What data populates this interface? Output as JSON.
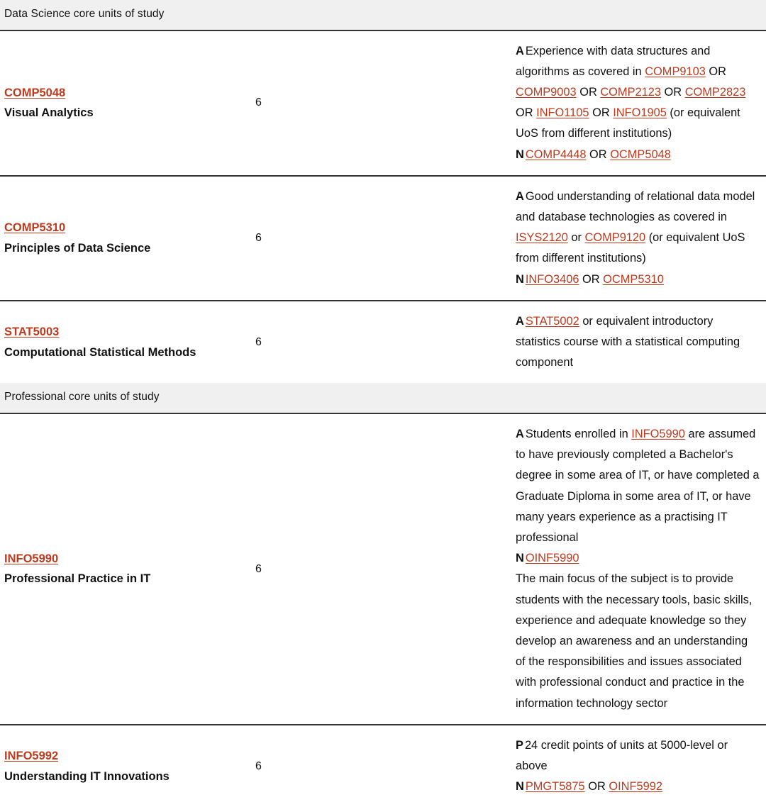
{
  "sections": [
    {
      "heading": "Data Science core units of study",
      "rows": [
        {
          "code": "COMP5048",
          "title": "Visual Analytics",
          "credit": "6",
          "requisites": [
            {
              "tag": "A",
              "parts": [
                {
                  "t": "text",
                  "v": "Experience with data structures and algorithms as covered in "
                },
                {
                  "t": "link",
                  "v": "COMP9103"
                },
                {
                  "t": "text",
                  "v": " OR "
                },
                {
                  "t": "link",
                  "v": "COMP9003"
                },
                {
                  "t": "text",
                  "v": " OR "
                },
                {
                  "t": "link",
                  "v": "COMP2123"
                },
                {
                  "t": "text",
                  "v": " OR "
                },
                {
                  "t": "link",
                  "v": "COMP2823"
                },
                {
                  "t": "text",
                  "v": " OR "
                },
                {
                  "t": "link",
                  "v": "INFO1105"
                },
                {
                  "t": "text",
                  "v": " OR "
                },
                {
                  "t": "link",
                  "v": "INFO1905"
                },
                {
                  "t": "text",
                  "v": " (or equivalent UoS from different institutions)"
                }
              ]
            },
            {
              "tag": "N",
              "parts": [
                {
                  "t": "link",
                  "v": "COMP4448"
                },
                {
                  "t": "text",
                  "v": " OR "
                },
                {
                  "t": "link",
                  "v": "OCMP5048"
                }
              ]
            }
          ],
          "description": ""
        },
        {
          "code": "COMP5310",
          "title": "Principles of Data Science",
          "credit": "6",
          "requisites": [
            {
              "tag": "A",
              "parts": [
                {
                  "t": "text",
                  "v": "Good understanding of relational data model and database technologies as covered in "
                },
                {
                  "t": "link",
                  "v": "ISYS2120"
                },
                {
                  "t": "text",
                  "v": " or "
                },
                {
                  "t": "link",
                  "v": "COMP9120"
                },
                {
                  "t": "text",
                  "v": " (or equivalent UoS from different institutions)"
                }
              ]
            },
            {
              "tag": "N",
              "parts": [
                {
                  "t": "link",
                  "v": "INFO3406"
                },
                {
                  "t": "text",
                  "v": " OR "
                },
                {
                  "t": "link",
                  "v": "OCMP5310"
                }
              ]
            }
          ],
          "description": ""
        },
        {
          "code": "STAT5003",
          "title": "Computational Statistical Methods",
          "credit": "6",
          "requisites": [
            {
              "tag": "A",
              "parts": [
                {
                  "t": "link",
                  "v": "STAT5002"
                },
                {
                  "t": "text",
                  "v": " or equivalent introductory statistics course with a statistical computing component"
                }
              ]
            }
          ],
          "description": ""
        }
      ]
    },
    {
      "heading": "Professional core units of study",
      "rows": [
        {
          "code": "INFO5990",
          "title": "Professional Practice in IT",
          "credit": "6",
          "requisites": [
            {
              "tag": "A",
              "parts": [
                {
                  "t": "text",
                  "v": "Students enrolled in "
                },
                {
                  "t": "link",
                  "v": "INFO5990"
                },
                {
                  "t": "text",
                  "v": " are assumed to have previously completed a Bachelor's degree in some area of IT, or have completed a Graduate Diploma in some area of IT, or have many years experience as a practising IT professional"
                }
              ]
            },
            {
              "tag": "N",
              "parts": [
                {
                  "t": "link",
                  "v": "OINF5990"
                }
              ]
            }
          ],
          "description": "The main focus of the subject is to provide students with the necessary tools, basic skills, experience and adequate knowledge so they develop an awareness and an understanding of the responsibilities and issues associated with professional conduct and practice in the information technology sector"
        },
        {
          "code": "INFO5992",
          "title": "Understanding IT Innovations",
          "credit": "6",
          "requisites": [
            {
              "tag": "P",
              "parts": [
                {
                  "t": "text",
                  "v": "24 credit points of units at 5000-level or above"
                }
              ]
            },
            {
              "tag": "N",
              "parts": [
                {
                  "t": "link",
                  "v": "PMGT5875"
                },
                {
                  "t": "text",
                  "v": " OR "
                },
                {
                  "t": "link",
                  "v": "OINF5992"
                }
              ]
            }
          ],
          "description": ""
        }
      ]
    }
  ],
  "colors": {
    "link": "#bf3a1d",
    "section_header_bg": "#f0f0f0",
    "rule": "#333333",
    "text": "#111111"
  }
}
